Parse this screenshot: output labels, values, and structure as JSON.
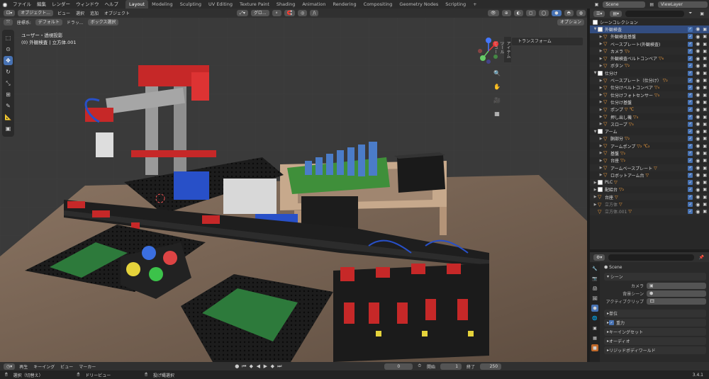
{
  "topbar": {
    "menus": [
      "ファイル",
      "編集",
      "レンダー",
      "ウィンドウ",
      "ヘルプ"
    ],
    "workspaces": [
      "Layout",
      "Modeling",
      "Sculpting",
      "UV Editing",
      "Texture Paint",
      "Shading",
      "Animation",
      "Rendering",
      "Compositing",
      "Geometry Nodes",
      "Scripting",
      "+"
    ],
    "active_workspace": "Layout",
    "scene": "Scene",
    "view_layer": "ViewLayer"
  },
  "viewport": {
    "mode": "オブジェクト...",
    "menus": [
      "ビュー",
      "選択",
      "追加",
      "オブジェクト"
    ],
    "orientation_label": "座標系:",
    "orientation": "デフォルト",
    "drag": "ドラッ...",
    "box_select": "ボックス選択",
    "options": "オプション",
    "global": "グロ...",
    "overlay_line1": "ユーザー・透視投影",
    "overlay_line2": "(0) 外観検査 | 立方体.001",
    "transform_panel": "トランスフォーム",
    "side_tabs": [
      "アイテム",
      "ツール",
      "ビュー"
    ]
  },
  "outliner": {
    "search_placeholder": "",
    "root": "シーンコレクション",
    "rows": [
      {
        "label": "外観検査",
        "type": "col",
        "level": 0,
        "sel": true,
        "arrow": "▼"
      },
      {
        "label": "外観検査基盤",
        "type": "mesh",
        "level": 1,
        "arrow": "▶"
      },
      {
        "label": "ベースプレート(外観検査)",
        "type": "mesh",
        "level": 1,
        "arrow": "▶"
      },
      {
        "label": "カメラ",
        "type": "mesh",
        "level": 1,
        "arrow": "▶",
        "suffix": "▽₂"
      },
      {
        "label": "外観検査ベルトコンベア",
        "type": "mesh",
        "level": 1,
        "arrow": "▶",
        "suffix": "▽₆"
      },
      {
        "label": "ボタン",
        "type": "mesh",
        "level": 1,
        "arrow": "▶",
        "suffix": "▽₂"
      },
      {
        "label": "仕分け",
        "type": "col",
        "level": 0,
        "arrow": "▼"
      },
      {
        "label": "ベースプレート（仕分け）",
        "type": "mesh",
        "level": 1,
        "arrow": "▶",
        "suffix": "▽₂"
      },
      {
        "label": "仕分けベルトコンベア",
        "type": "mesh",
        "level": 1,
        "arrow": "▶",
        "suffix": "▽₄"
      },
      {
        "label": "仕分けフォトセンサー",
        "type": "mesh",
        "level": 1,
        "arrow": "▶",
        "suffix": "▽₃"
      },
      {
        "label": "仕分け基盤",
        "type": "mesh",
        "level": 1,
        "arrow": "▶"
      },
      {
        "label": "ポンプ",
        "type": "mesh",
        "level": 1,
        "arrow": "▶",
        "suffix": "▽ ℃"
      },
      {
        "label": "押し出し機",
        "type": "mesh",
        "level": 1,
        "arrow": "▶",
        "suffix": "▽₃"
      },
      {
        "label": "スロープ",
        "type": "mesh",
        "level": 1,
        "arrow": "▶",
        "suffix": "▽₃"
      },
      {
        "label": "アーム",
        "type": "col",
        "level": 0,
        "arrow": "▼"
      },
      {
        "label": "胴部分",
        "type": "mesh",
        "level": 1,
        "arrow": "▶",
        "suffix": "▽₂"
      },
      {
        "label": "アームポンプ",
        "type": "mesh",
        "level": 1,
        "arrow": "▶",
        "suffix": "▽₂ ℃₂"
      },
      {
        "label": "基盤",
        "type": "mesh",
        "level": 1,
        "arrow": "▶",
        "suffix": "▽₂"
      },
      {
        "label": "台座",
        "type": "mesh",
        "level": 1,
        "arrow": "▶",
        "suffix": "▽₂"
      },
      {
        "label": "アームベースプレート",
        "type": "mesh",
        "level": 1,
        "arrow": "▶",
        "suffix": "▽"
      },
      {
        "label": "ロボットアーム台",
        "type": "mesh",
        "level": 1,
        "arrow": "▶",
        "suffix": "▽"
      },
      {
        "label": "PLC",
        "type": "col",
        "level": 0,
        "arrow": "▶",
        "suffix": "▽"
      },
      {
        "label": "配給台",
        "type": "col",
        "level": 0,
        "arrow": "▶",
        "suffix": "▽₂"
      },
      {
        "label": "台座",
        "type": "mesh",
        "level": 0,
        "arrow": "▶",
        "suffix": "▽"
      },
      {
        "label": "立方体",
        "type": "mesh",
        "level": 0,
        "arrow": "▶",
        "suffix": "▽",
        "dim": true
      },
      {
        "label": "立方体.001",
        "type": "mesh",
        "level": 0,
        "arrow": "",
        "suffix": "▽",
        "dim": true
      }
    ]
  },
  "properties": {
    "scene_name": "Scene",
    "section": "シーン",
    "camera_label": "カメラ",
    "bg_scene_label": "背景シーン",
    "active_clip_label": "アクティブクリップ",
    "sections": [
      "単位",
      "重力",
      "キーイングセット",
      "オーディオ",
      "リジッドボディワールド"
    ],
    "gravity_checked": true
  },
  "timeline": {
    "playback": "再生",
    "keying": "キーイング",
    "view": "ビュー",
    "marker": "マーカー",
    "current_frame": "0",
    "start_label": "開始",
    "start": "1",
    "end_label": "終了",
    "end": "250"
  },
  "status": {
    "select": "選択（切替え）",
    "dolly": "ドリービュー",
    "lasso": "投げ縄選択",
    "version": "3.4.1"
  }
}
